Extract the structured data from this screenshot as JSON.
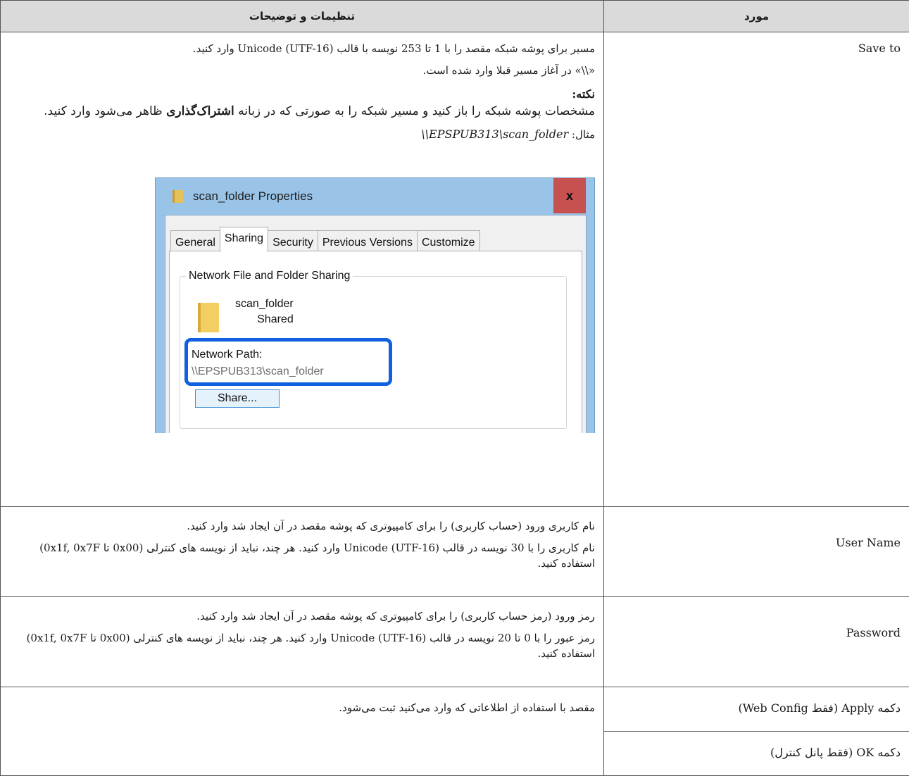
{
  "header": {
    "col_item": "مورد",
    "col_desc": "تنظیمات و توضیحات"
  },
  "rows": {
    "save_to": {
      "item": "Save to",
      "p1": "مسیر برای پوشه شبکه مقصد را با 1 تا 253 نویسه با قالب (Unicode (UTF-16 وارد کنید.",
      "p2": "«\\\\» در آغاز مسیر قبلا وارد شده است.",
      "note_title": "نکته:",
      "note_text_a": "مشخصات پوشه شبکه را باز کنید و مسیر شبکه را به صورتی که در زبانه ",
      "note_bold": "اشتراک‌گذاری",
      "note_text_b": " ظاهر می‌شود وارد کنید.",
      "example_label": "مثال: ",
      "example_value": "\\\\EPSPUB313\\scan_folder"
    },
    "user_name": {
      "item": "User Name",
      "p1": "نام کاربری ورود (حساب کاربری) را برای کامپیوتری که پوشه مقصد در آن ایجاد شد وارد کنید.",
      "p2": "نام کاربری را با 30 نویسه در قالب (Unicode (UTF-16 وارد کنید. هر چند، نباید از نویسه های کنترلی (0x00 تا 0x1f, 0x7F) استفاده کنید."
    },
    "password": {
      "item": "Password",
      "p1": "رمز ورود (رمز حساب کاربری) را برای کامپیوتری که پوشه مقصد در آن ایجاد شد وارد کنید.",
      "p2": "رمز عبور را با 0 تا 20 نویسه در قالب (Unicode (UTF-16 وارد کنید. هر چند، نباید از نویسه های کنترلی (0x00 تا 0x1f, 0x7F) استفاده کنید."
    },
    "apply": {
      "item": "دکمه Apply (فقط Web Config)",
      "desc": "مقصد با استفاده از اطلاعاتی که وارد می‌کنید ثبت می‌شود."
    },
    "ok": {
      "item": "دکمه OK (فقط پانل کنترل)"
    }
  },
  "dialog": {
    "title": "scan_folder Properties",
    "close": "x",
    "tabs": [
      "General",
      "Sharing",
      "Security",
      "Previous Versions",
      "Customize"
    ],
    "active_tab": "Sharing",
    "group_legend": "Network File and Folder Sharing",
    "folder_name": "scan_folder",
    "folder_status": "Shared",
    "path_label": "Network Path:",
    "path_value": "\\\\EPSPUB313\\scan_folder",
    "share_button": "Share..."
  },
  "colors": {
    "header_bg": "#dadada",
    "title_bar": "#99c4e8",
    "close_red": "#c75050",
    "highlight": "#1060e0"
  }
}
